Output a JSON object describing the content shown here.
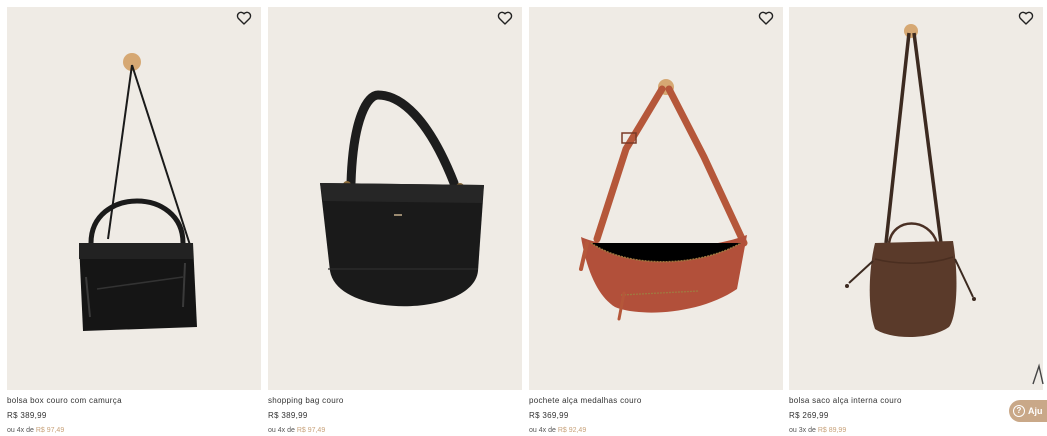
{
  "products": [
    {
      "name": "bolsa box couro com camurça",
      "price": "R$ 389,99",
      "installment_prefix": "ou 4x de",
      "installment_value": "R$ 97,49"
    },
    {
      "name": "shopping bag couro",
      "price": "R$ 389,99",
      "installment_prefix": "ou 4x de",
      "installment_value": "R$ 97,49"
    },
    {
      "name": "pochete alça medalhas couro",
      "price": "R$ 369,99",
      "installment_prefix": "ou 4x de",
      "installment_value": "R$ 92,49"
    },
    {
      "name": "bolsa saco alça interna couro",
      "price": "R$ 269,99",
      "installment_prefix": "ou 3x de",
      "installment_value": "R$ 89,99"
    }
  ],
  "help_widget": {
    "label": "Aju"
  },
  "colors": {
    "photo_bg": "#efebe5",
    "accent": "#c8a27a",
    "help_bg": "#c9a888"
  },
  "icons": {
    "favorite": "heart-outline-icon",
    "help": "question-circle-icon"
  }
}
